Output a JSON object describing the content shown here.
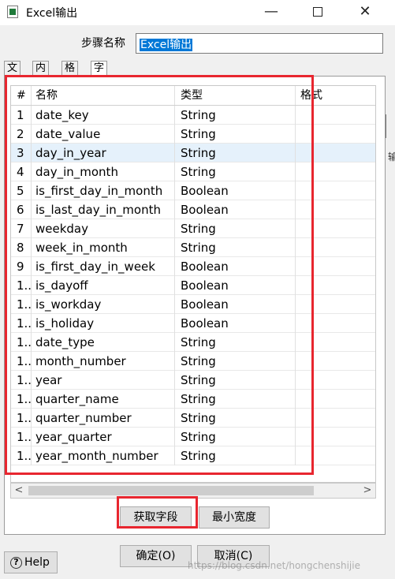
{
  "window": {
    "title": "Excel输出",
    "controls": {
      "minimize": "—",
      "maximize": "",
      "close": "✕"
    }
  },
  "step": {
    "label": "步骤名称",
    "value": "Excel输出"
  },
  "tabs": [
    {
      "label": "文件",
      "active": false
    },
    {
      "label": "内容",
      "active": false
    },
    {
      "label": "格式",
      "active": false
    },
    {
      "label": "字段",
      "active": true
    }
  ],
  "table": {
    "columns": [
      "#",
      "名称",
      "类型",
      "格式"
    ],
    "rows": [
      {
        "num": "1",
        "name": "date_key",
        "type": "String"
      },
      {
        "num": "2",
        "name": "date_value",
        "type": "String"
      },
      {
        "num": "3",
        "name": "day_in_year",
        "type": "String",
        "selected": true
      },
      {
        "num": "4",
        "name": "day_in_month",
        "type": "String"
      },
      {
        "num": "5",
        "name": "is_first_day_in_month",
        "type": "Boolean"
      },
      {
        "num": "6",
        "name": "is_last_day_in_month",
        "type": "Boolean"
      },
      {
        "num": "7",
        "name": "weekday",
        "type": "String"
      },
      {
        "num": "8",
        "name": "week_in_month",
        "type": "String"
      },
      {
        "num": "9",
        "name": "is_first_day_in_week",
        "type": "Boolean"
      },
      {
        "num": "1..",
        "name": "is_dayoff",
        "type": "Boolean"
      },
      {
        "num": "1..",
        "name": "is_workday",
        "type": "Boolean"
      },
      {
        "num": "1..",
        "name": "is_holiday",
        "type": "Boolean"
      },
      {
        "num": "1..",
        "name": "date_type",
        "type": "String"
      },
      {
        "num": "1..",
        "name": "month_number",
        "type": "String"
      },
      {
        "num": "1..",
        "name": "year",
        "type": "String"
      },
      {
        "num": "1..",
        "name": "quarter_name",
        "type": "String"
      },
      {
        "num": "1..",
        "name": "quarter_number",
        "type": "String"
      },
      {
        "num": "1..",
        "name": "year_quarter",
        "type": "String"
      },
      {
        "num": "1..",
        "name": "year_month_number",
        "type": "String"
      }
    ]
  },
  "scrollbar": {
    "left_arrow": "<",
    "right_arrow": ">"
  },
  "buttons": {
    "get_fields": "获取字段",
    "min_width": "最小宽度",
    "ok": "确定(O)",
    "cancel": "取消(C)",
    "help": "Help",
    "help_icon": "?"
  },
  "side_char": "输",
  "watermark": "https://blog.csdn.net/hongchenshijie",
  "colors": {
    "highlight": "#e8262f",
    "selection": "#0078d7",
    "row_selected": "#e5f1fb"
  }
}
